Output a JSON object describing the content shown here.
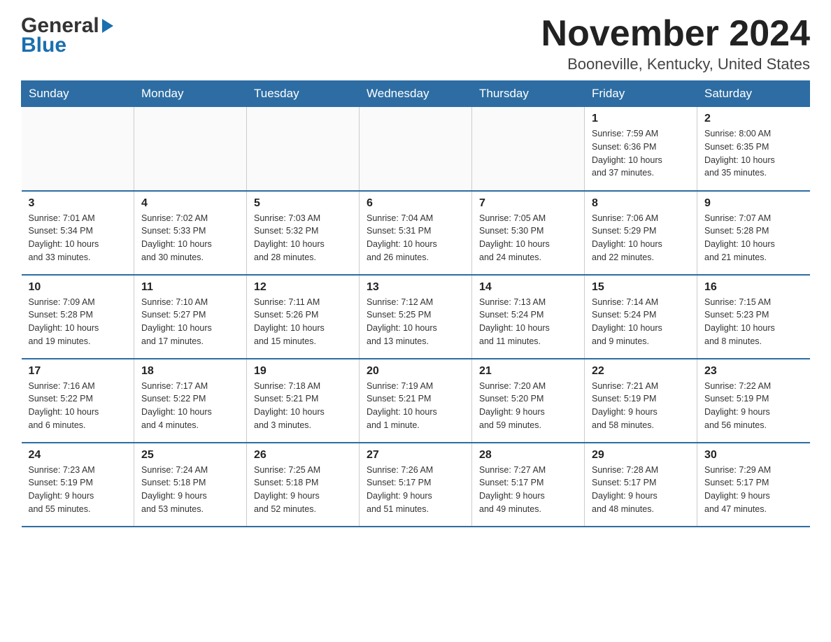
{
  "header": {
    "logo_line1": "General",
    "logo_line2": "Blue",
    "title": "November 2024",
    "subtitle": "Booneville, Kentucky, United States"
  },
  "weekdays": [
    "Sunday",
    "Monday",
    "Tuesday",
    "Wednesday",
    "Thursday",
    "Friday",
    "Saturday"
  ],
  "weeks": [
    [
      {
        "day": "",
        "info": ""
      },
      {
        "day": "",
        "info": ""
      },
      {
        "day": "",
        "info": ""
      },
      {
        "day": "",
        "info": ""
      },
      {
        "day": "",
        "info": ""
      },
      {
        "day": "1",
        "info": "Sunrise: 7:59 AM\nSunset: 6:36 PM\nDaylight: 10 hours\nand 37 minutes."
      },
      {
        "day": "2",
        "info": "Sunrise: 8:00 AM\nSunset: 6:35 PM\nDaylight: 10 hours\nand 35 minutes."
      }
    ],
    [
      {
        "day": "3",
        "info": "Sunrise: 7:01 AM\nSunset: 5:34 PM\nDaylight: 10 hours\nand 33 minutes."
      },
      {
        "day": "4",
        "info": "Sunrise: 7:02 AM\nSunset: 5:33 PM\nDaylight: 10 hours\nand 30 minutes."
      },
      {
        "day": "5",
        "info": "Sunrise: 7:03 AM\nSunset: 5:32 PM\nDaylight: 10 hours\nand 28 minutes."
      },
      {
        "day": "6",
        "info": "Sunrise: 7:04 AM\nSunset: 5:31 PM\nDaylight: 10 hours\nand 26 minutes."
      },
      {
        "day": "7",
        "info": "Sunrise: 7:05 AM\nSunset: 5:30 PM\nDaylight: 10 hours\nand 24 minutes."
      },
      {
        "day": "8",
        "info": "Sunrise: 7:06 AM\nSunset: 5:29 PM\nDaylight: 10 hours\nand 22 minutes."
      },
      {
        "day": "9",
        "info": "Sunrise: 7:07 AM\nSunset: 5:28 PM\nDaylight: 10 hours\nand 21 minutes."
      }
    ],
    [
      {
        "day": "10",
        "info": "Sunrise: 7:09 AM\nSunset: 5:28 PM\nDaylight: 10 hours\nand 19 minutes."
      },
      {
        "day": "11",
        "info": "Sunrise: 7:10 AM\nSunset: 5:27 PM\nDaylight: 10 hours\nand 17 minutes."
      },
      {
        "day": "12",
        "info": "Sunrise: 7:11 AM\nSunset: 5:26 PM\nDaylight: 10 hours\nand 15 minutes."
      },
      {
        "day": "13",
        "info": "Sunrise: 7:12 AM\nSunset: 5:25 PM\nDaylight: 10 hours\nand 13 minutes."
      },
      {
        "day": "14",
        "info": "Sunrise: 7:13 AM\nSunset: 5:24 PM\nDaylight: 10 hours\nand 11 minutes."
      },
      {
        "day": "15",
        "info": "Sunrise: 7:14 AM\nSunset: 5:24 PM\nDaylight: 10 hours\nand 9 minutes."
      },
      {
        "day": "16",
        "info": "Sunrise: 7:15 AM\nSunset: 5:23 PM\nDaylight: 10 hours\nand 8 minutes."
      }
    ],
    [
      {
        "day": "17",
        "info": "Sunrise: 7:16 AM\nSunset: 5:22 PM\nDaylight: 10 hours\nand 6 minutes."
      },
      {
        "day": "18",
        "info": "Sunrise: 7:17 AM\nSunset: 5:22 PM\nDaylight: 10 hours\nand 4 minutes."
      },
      {
        "day": "19",
        "info": "Sunrise: 7:18 AM\nSunset: 5:21 PM\nDaylight: 10 hours\nand 3 minutes."
      },
      {
        "day": "20",
        "info": "Sunrise: 7:19 AM\nSunset: 5:21 PM\nDaylight: 10 hours\nand 1 minute."
      },
      {
        "day": "21",
        "info": "Sunrise: 7:20 AM\nSunset: 5:20 PM\nDaylight: 9 hours\nand 59 minutes."
      },
      {
        "day": "22",
        "info": "Sunrise: 7:21 AM\nSunset: 5:19 PM\nDaylight: 9 hours\nand 58 minutes."
      },
      {
        "day": "23",
        "info": "Sunrise: 7:22 AM\nSunset: 5:19 PM\nDaylight: 9 hours\nand 56 minutes."
      }
    ],
    [
      {
        "day": "24",
        "info": "Sunrise: 7:23 AM\nSunset: 5:19 PM\nDaylight: 9 hours\nand 55 minutes."
      },
      {
        "day": "25",
        "info": "Sunrise: 7:24 AM\nSunset: 5:18 PM\nDaylight: 9 hours\nand 53 minutes."
      },
      {
        "day": "26",
        "info": "Sunrise: 7:25 AM\nSunset: 5:18 PM\nDaylight: 9 hours\nand 52 minutes."
      },
      {
        "day": "27",
        "info": "Sunrise: 7:26 AM\nSunset: 5:17 PM\nDaylight: 9 hours\nand 51 minutes."
      },
      {
        "day": "28",
        "info": "Sunrise: 7:27 AM\nSunset: 5:17 PM\nDaylight: 9 hours\nand 49 minutes."
      },
      {
        "day": "29",
        "info": "Sunrise: 7:28 AM\nSunset: 5:17 PM\nDaylight: 9 hours\nand 48 minutes."
      },
      {
        "day": "30",
        "info": "Sunrise: 7:29 AM\nSunset: 5:17 PM\nDaylight: 9 hours\nand 47 minutes."
      }
    ]
  ]
}
